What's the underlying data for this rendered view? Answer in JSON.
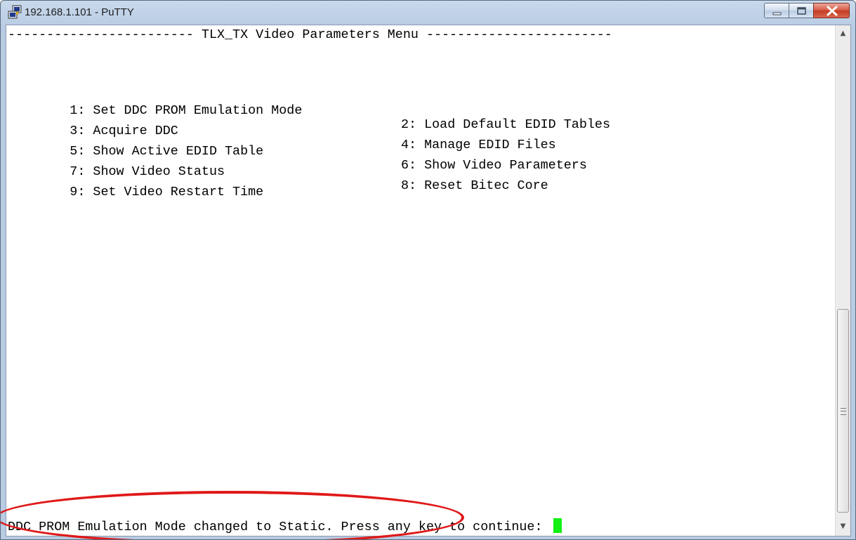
{
  "window": {
    "title": "192.168.1.101 - PuTTY",
    "icon": "putty-icon"
  },
  "controls": {
    "minimize_icon": "minimize-icon",
    "maximize_icon": "maximize-icon",
    "close_icon": "close-icon"
  },
  "terminal": {
    "header": "------------------------ TLX_TX Video Parameters Menu ------------------------",
    "menu_items": [
      [
        "1: Set DDC PROM Emulation Mode",
        "2: Load Default EDID Tables"
      ],
      [
        "3: Acquire DDC",
        "4: Manage EDID Files"
      ],
      [
        "5: Show Active EDID Table",
        "6: Show Video Parameters"
      ],
      [
        "7: Show Video Status",
        "8: Reset Bitec Core"
      ],
      [
        "9: Set Video Restart Time",
        ""
      ]
    ],
    "status_line": "DDC PROM Emulation Mode changed to Static. Press any key to continue: ",
    "cursor_color": "#13f013"
  },
  "colors": {
    "titlebar": "#b7cbe2",
    "close_button": "#c23c22",
    "annotation": "#e01818"
  }
}
